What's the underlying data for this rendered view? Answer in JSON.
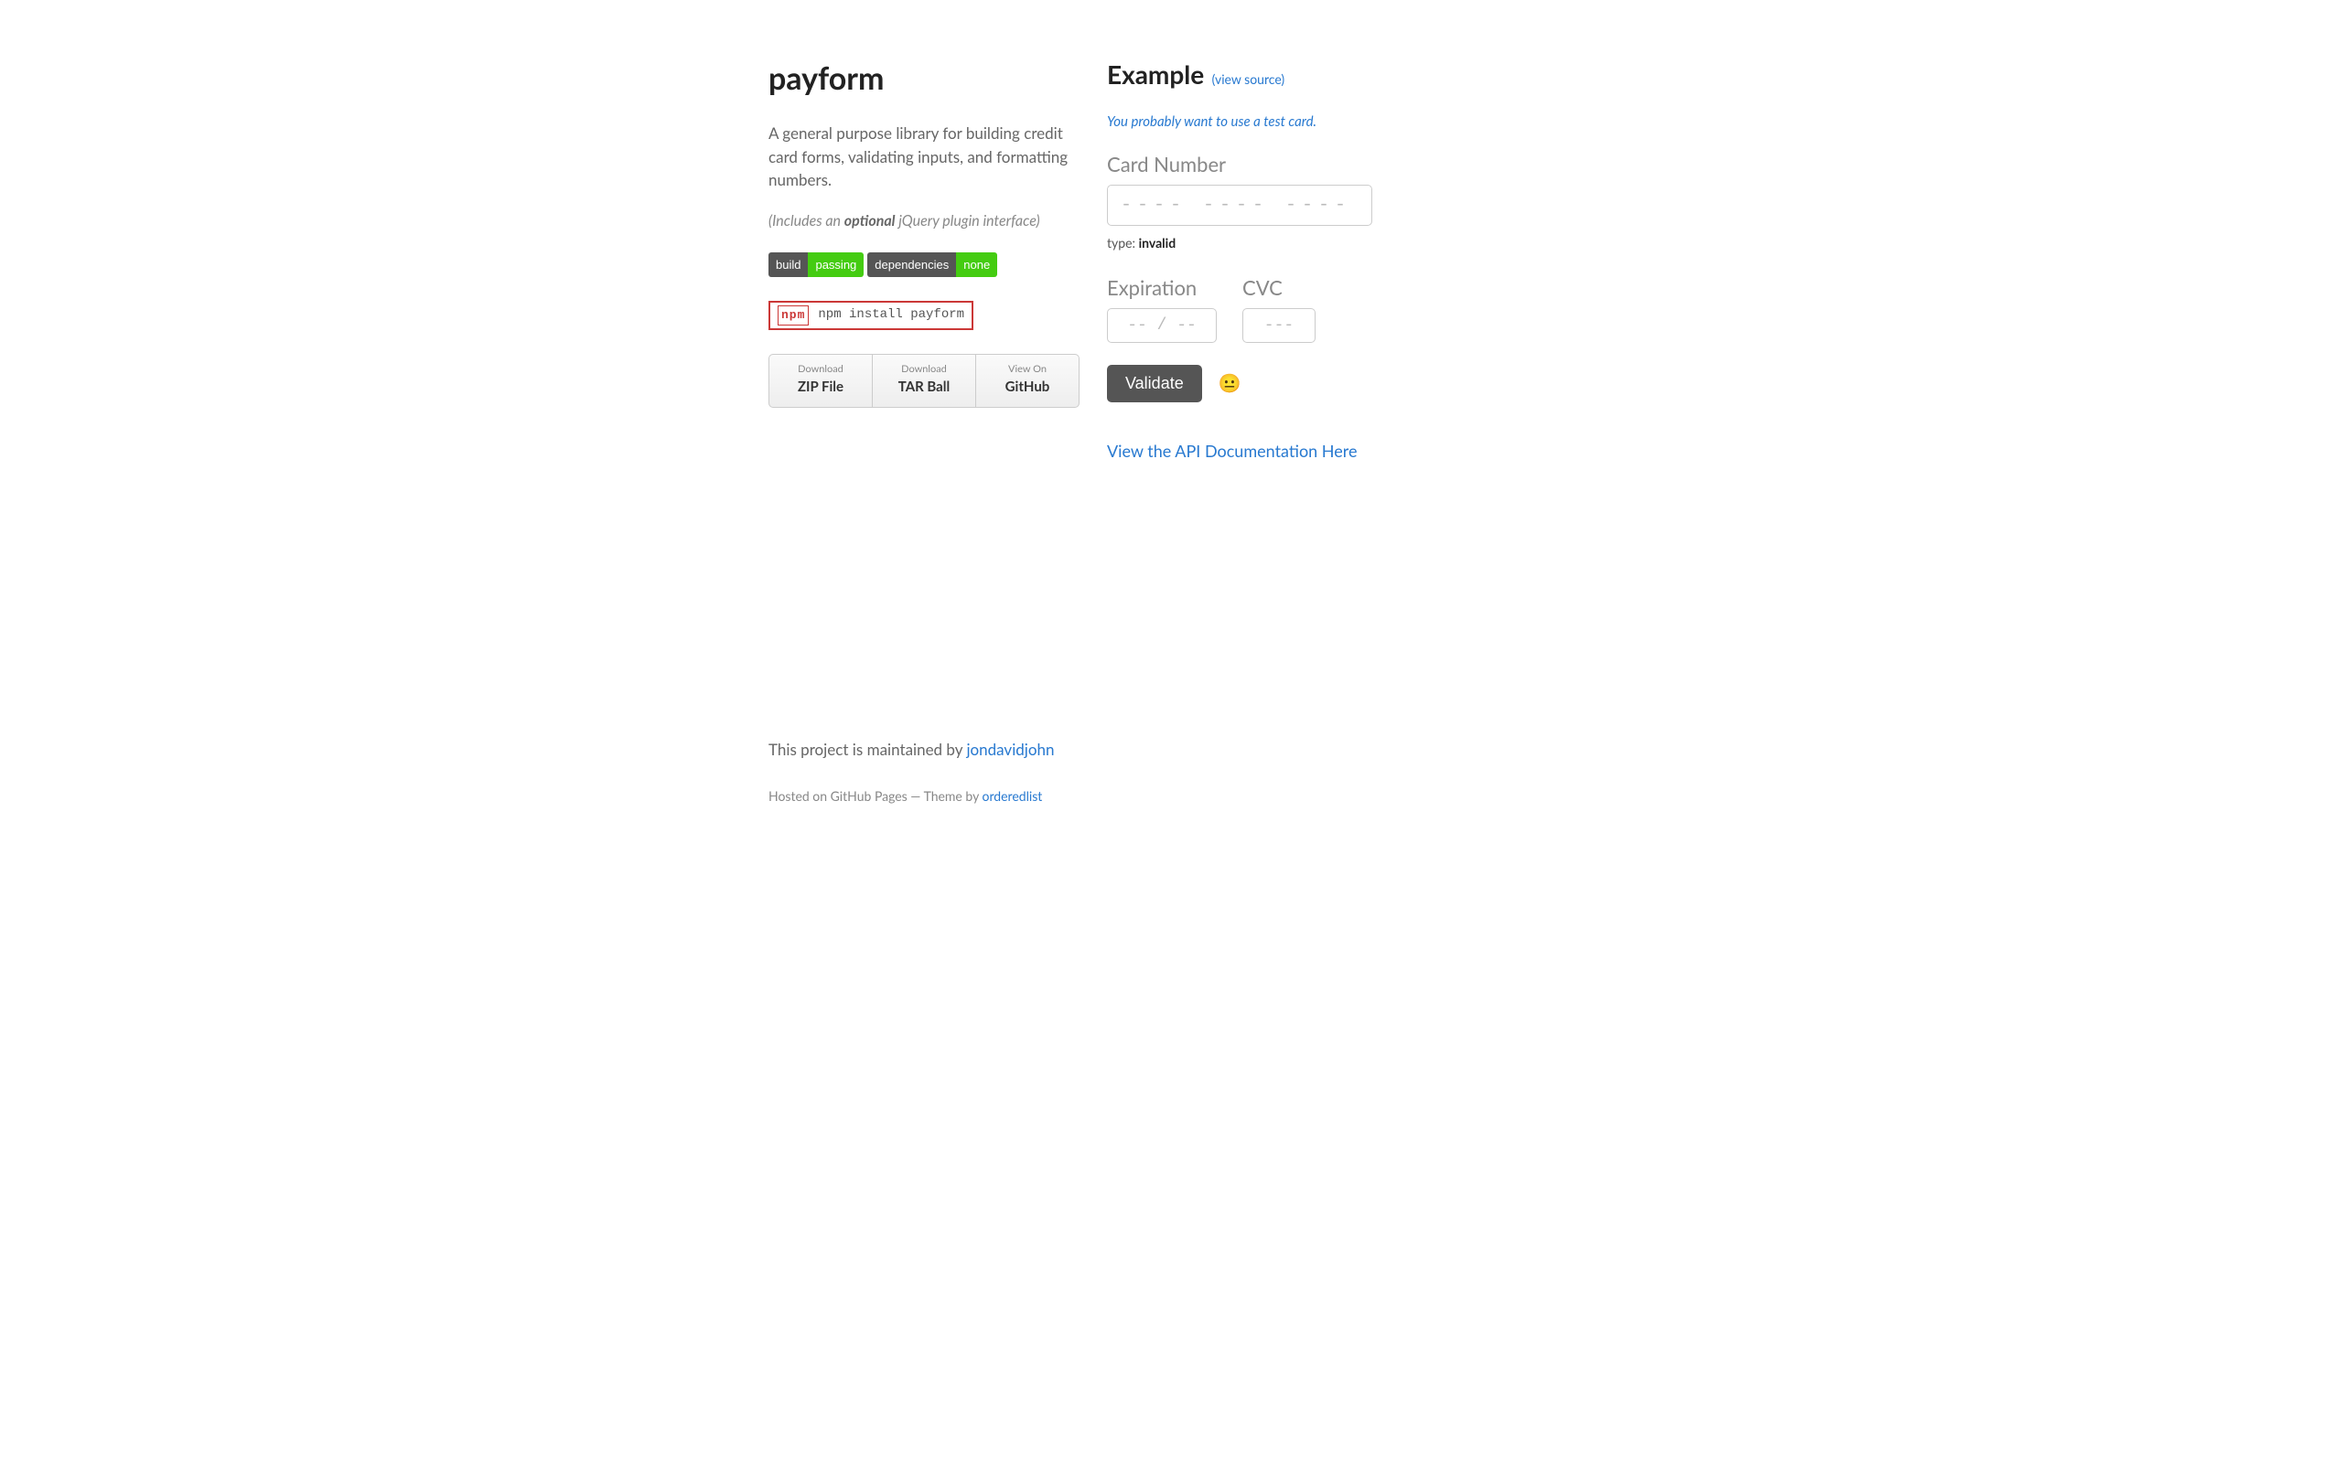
{
  "header": {
    "title": "payform",
    "description": "A general purpose library for building credit card forms, validating inputs, and formatting numbers.",
    "subnote_prefix": "(Includes an ",
    "subnote_strong": "optional",
    "subnote_suffix": " jQuery plugin interface)"
  },
  "badges": {
    "build": {
      "label": "build",
      "value": "passing"
    },
    "deps": {
      "label": "dependencies",
      "value": "none"
    }
  },
  "npm": {
    "logo": "npm",
    "command": "npm install payform"
  },
  "downloads": {
    "zip": {
      "top": "Download",
      "bottom": "ZIP File"
    },
    "tar": {
      "top": "Download",
      "bottom": "TAR Ball"
    },
    "gh": {
      "top": "View On",
      "bottom": "GitHub"
    }
  },
  "example": {
    "heading": "Example",
    "view_source": "(view source)",
    "tip": "You probably want to use a test card.",
    "card_label": "Card Number",
    "card_placeholder": "---- ---- ---- ----",
    "type_label": "type: ",
    "type_value": "invalid",
    "exp_label": "Expiration",
    "exp_placeholder": "-- / --",
    "cvc_label": "CVC",
    "cvc_placeholder": "---",
    "validate_label": "Validate",
    "emoji": "😐",
    "api_link": "View the API Documentation Here"
  },
  "footer": {
    "maintained_prefix": "This project is maintained by ",
    "maintained_link": "jondavidjohn",
    "hosted_prefix": "Hosted on GitHub Pages — Theme by ",
    "hosted_link": "orderedlist"
  }
}
